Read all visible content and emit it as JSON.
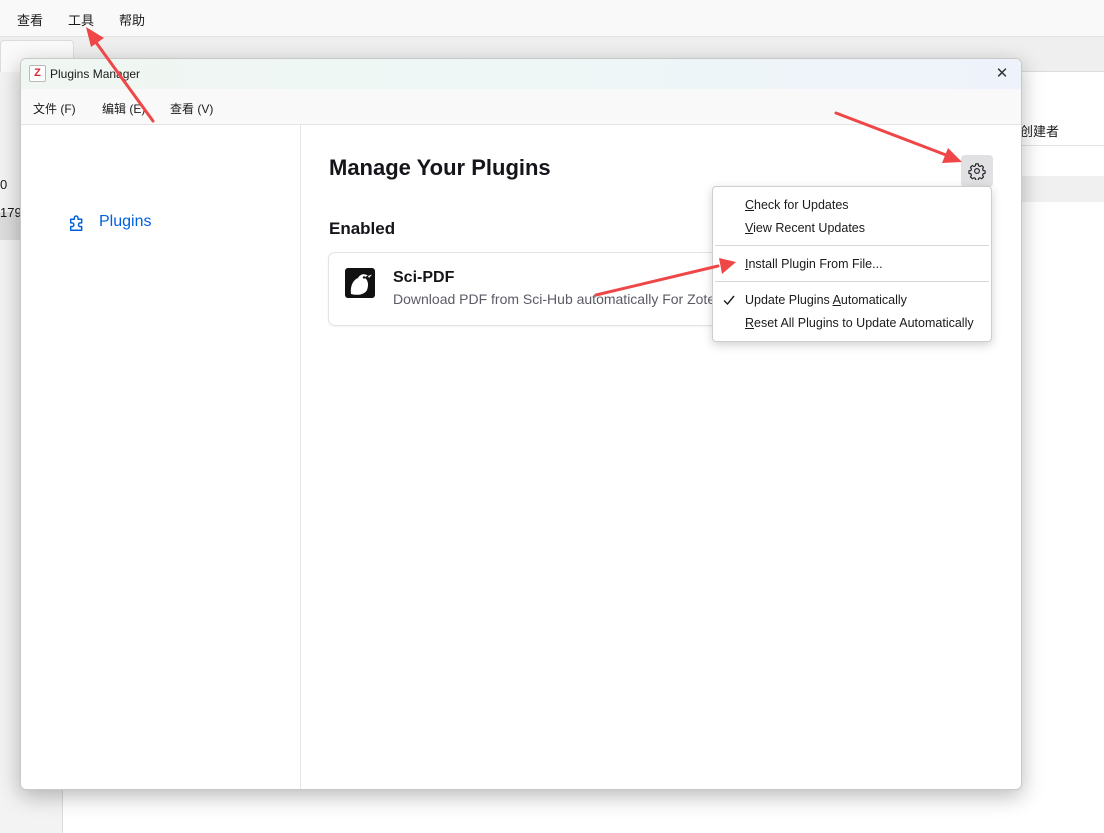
{
  "background": {
    "menu": [
      "查看",
      "工具",
      "帮助"
    ],
    "left_items": [
      "0",
      "179"
    ],
    "column_header": "创建者"
  },
  "dialog": {
    "title": "Plugins Manager",
    "icon_letter": "Z",
    "close_glyph": "✕",
    "menu": [
      "文件 (F)",
      "编辑 (E)",
      "查看 (V)"
    ],
    "sidebar": {
      "item_label": "Plugins"
    },
    "main": {
      "title": "Manage Your Plugins",
      "section": "Enabled",
      "plugin": {
        "name": "Sci-PDF",
        "description": "Download PDF from Sci-Hub automatically For Zotero"
      }
    },
    "popup_menu": {
      "items": [
        {
          "access": "C",
          "rest": "heck for Updates"
        },
        {
          "access": "V",
          "rest": "iew Recent Updates"
        },
        {
          "access": "I",
          "rest": "nstall Plugin From File..."
        },
        {
          "before": "Update Plugins ",
          "access": "A",
          "rest": "utomatically",
          "checked": true
        },
        {
          "access": "R",
          "rest": "eset All Plugins to Update Automatically"
        }
      ]
    }
  },
  "icons": {
    "app": "zotero-z-icon",
    "close": "close-icon",
    "plugins": "puzzle-piece-icon",
    "gear": "gear-icon",
    "plugin": "bird-icon",
    "check": "checkmark-icon"
  },
  "colors": {
    "accent": "#0061e0",
    "annotation_arrow": "#ef4747",
    "zotero_red": "#d12b32"
  }
}
